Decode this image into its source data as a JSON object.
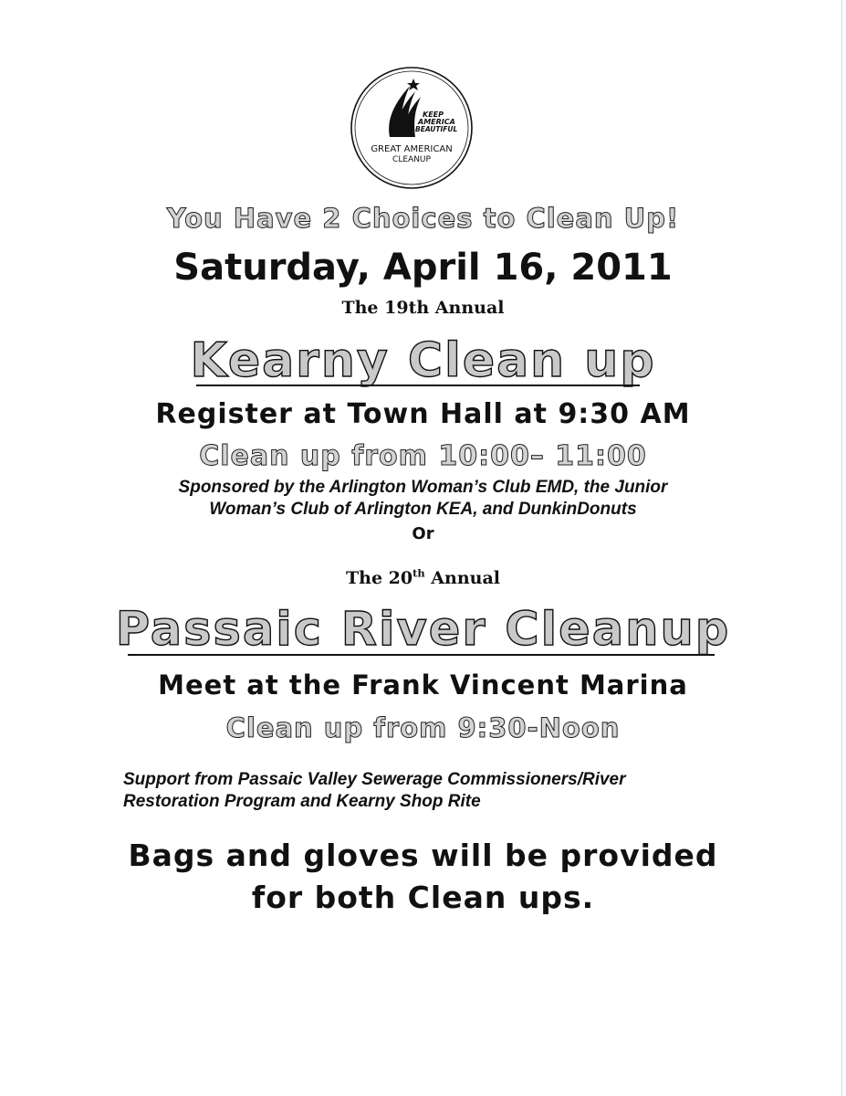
{
  "logo": {
    "line1": "KEEP",
    "line2": "AMERICA",
    "line3": "BEAUTIFUL",
    "line4": "GREAT AMERICAN",
    "line5": "CLEANUP"
  },
  "headline": "You Have 2 Choices to Clean Up!",
  "date": "Saturday, April 16, 2011",
  "kearny": {
    "annual_label": "The 19th Annual",
    "title": "Kearny Clean up",
    "register": "Register at Town Hall at 9:30 AM",
    "time": "Clean up from 10:00– 11:00",
    "sponsor_line1": "Sponsored by the Arlington Woman’s Club EMD, the Junior",
    "sponsor_line2": "Woman’s Club of Arlington KEA, and DunkinDonuts"
  },
  "or_label": "Or",
  "passaic": {
    "annual_prefix": "The 20",
    "annual_sup": "th",
    "annual_suffix": " Annual",
    "title": "Passaic River Cleanup",
    "meet": "Meet at the Frank Vincent Marina",
    "time": "Clean up from 9:30-Noon",
    "support_line1": "Support from  Passaic Valley  Sewerage Commissioners/River",
    "support_line2": "Restoration Program and Kearny Shop Rite"
  },
  "footer": {
    "line1": "Bags and gloves will be provided",
    "line2": "for both Clean ups."
  }
}
